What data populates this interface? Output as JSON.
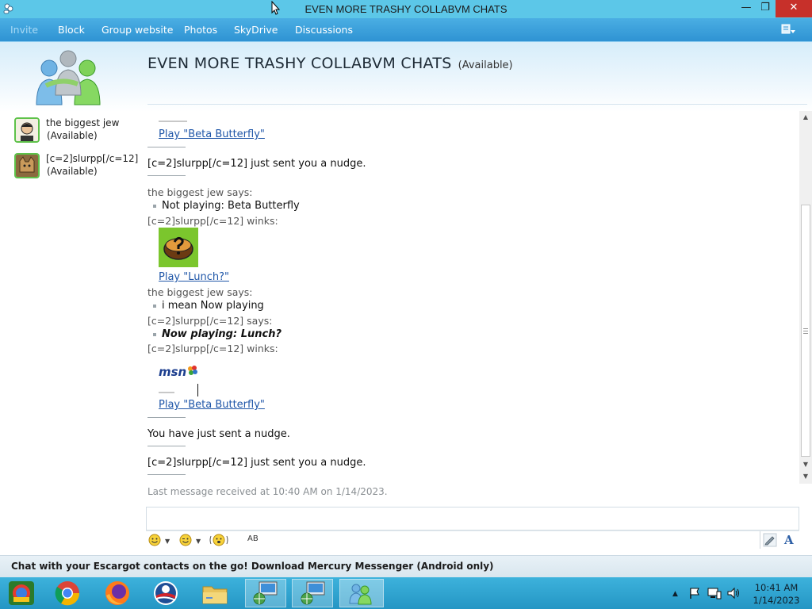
{
  "window": {
    "title": "EVEN MORE TRASHY COLLABVM CHATS",
    "min_glyph": "—",
    "max_glyph": "❐",
    "close_glyph": "✕"
  },
  "toolbar": {
    "items": [
      "Invite",
      "Block",
      "Group website",
      "Photos",
      "SkyDrive",
      "Discussions"
    ]
  },
  "conversation": {
    "title": "EVEN MORE TRASHY COLLABVM CHATS",
    "status": "(Available)"
  },
  "contacts": [
    {
      "name": "the biggest jew",
      "status": "(Available)"
    },
    {
      "name": "[c=2]slurpp[/c=12]",
      "status": "(Available)"
    }
  ],
  "history": {
    "play_beta_1": "Play \"Beta Butterfly\"",
    "nudge_1": "[c=2]slurpp[/c=12] just sent you a nudge.",
    "says_1": "the biggest jew says:",
    "msg_1": "Not playing: Beta Butterfly",
    "winks_1": "[c=2]slurpp[/c=12] winks:",
    "play_lunch": "Play \"Lunch?\"",
    "says_2": "the biggest jew says:",
    "msg_2": "i mean Now playing",
    "says_3": "[c=2]slurpp[/c=12] says:",
    "msg_3": "Now playing: Lunch?",
    "winks_2": "[c=2]slurpp[/c=12] winks:",
    "msn_logo_text": "msn",
    "play_beta_2": "Play \"Beta Butterfly\"",
    "sent_nudge": "You have just sent a nudge.",
    "nudge_2": "[c=2]slurpp[/c=12] just sent you a nudge."
  },
  "last_message": "Last message received at 10:40 AM on 1/14/2023.",
  "input_toolbar": {
    "emoticon_icon": "smiley-icon",
    "wink_icon": "wink-icon",
    "nudge_icon": "nudge-icon",
    "font_icon": "font-icon",
    "handwriting_icon": "handwriting-icon",
    "text_style_label": "A",
    "ab_label": "AB"
  },
  "ad": {
    "text": "Chat with your Escargot contacts on the go! Download Mercury Messenger (Android only)"
  },
  "taskbar": {
    "time": "10:41 AM",
    "date": "1/14/2023"
  },
  "colors": {
    "titlebar": "#5cc7e8",
    "toolbar": "#2f93d3",
    "link": "#1f56a8",
    "close": "#c7302a",
    "taskbar": "#2496c4"
  }
}
